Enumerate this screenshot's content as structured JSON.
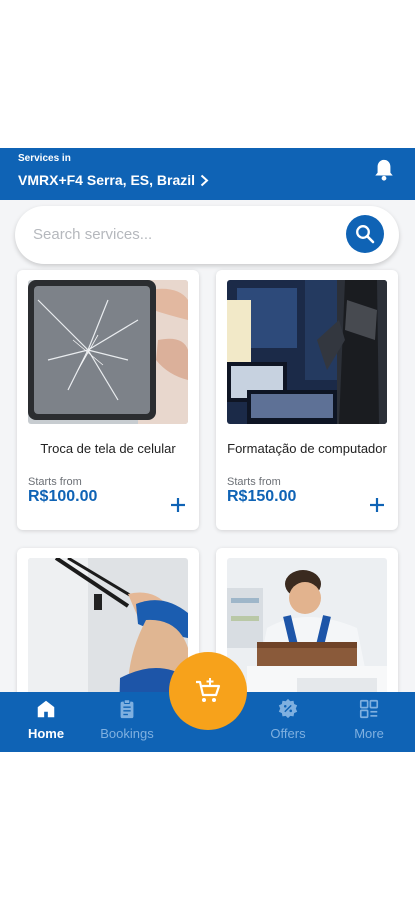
{
  "header": {
    "services_label": "Services in",
    "location": "VMRX+F4 Serra, ES, Brazil"
  },
  "search": {
    "placeholder": "Search services..."
  },
  "services": [
    {
      "title": "Troca de tela de celular",
      "starts_label": "Starts from",
      "price": "R$100.00"
    },
    {
      "title": "Formatação de computador",
      "starts_label": "Starts from",
      "price": "R$150.00"
    }
  ],
  "nav": {
    "home": "Home",
    "bookings": "Bookings",
    "offers": "Offers",
    "more": "More"
  },
  "colors": {
    "primary": "#0f63b5",
    "accent": "#f7a21b",
    "background": "#f4f5f7"
  },
  "icons": {
    "bell": "bell-icon",
    "search": "search-icon",
    "cart": "cart-plus-icon",
    "home": "home-icon",
    "bookings": "clipboard-icon",
    "offers": "discount-badge-icon",
    "more": "grid-menu-icon"
  }
}
